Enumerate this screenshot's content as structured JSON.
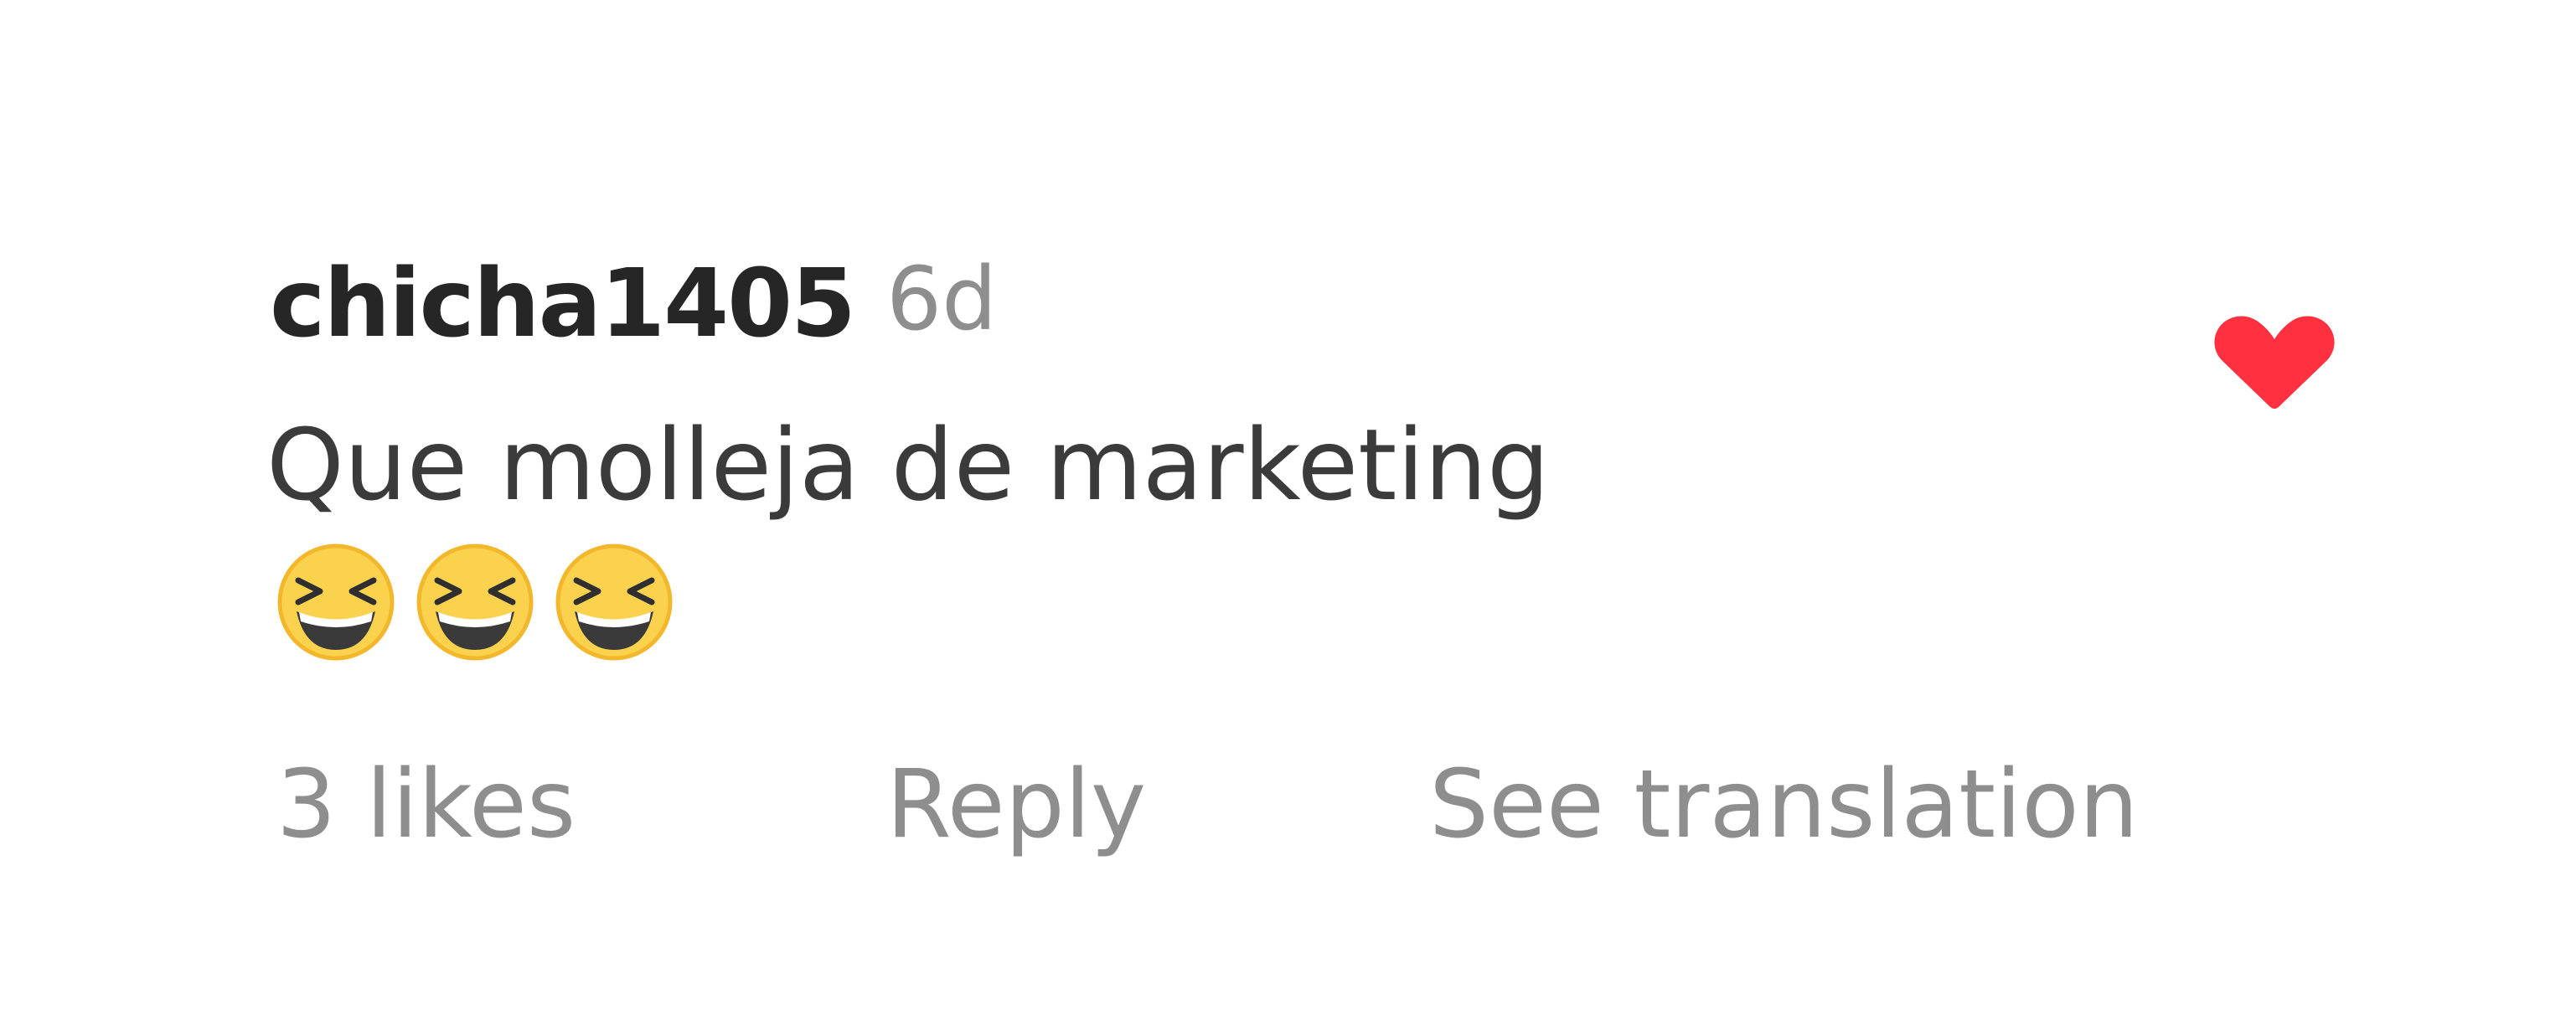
{
  "comment": {
    "username": "chicha1405",
    "timestamp": "6d",
    "text": "Que molleja de marketing",
    "emojis": [
      "laughing-face-emoji",
      "laughing-face-emoji",
      "laughing-face-emoji"
    ],
    "liked": true
  },
  "actions": {
    "likes_label": "3 likes",
    "reply_label": "Reply",
    "translation_label": "See translation"
  },
  "colors": {
    "username": "#262626",
    "secondary_text": "#8e8e8e",
    "body_text": "#3b3b3b",
    "heart": "#ff3040",
    "emoji_face": "#fbd24e",
    "emoji_outline": "#f3b72c"
  },
  "icons": {
    "like": "heart-icon",
    "emoji": "laughing-face-emoji"
  }
}
